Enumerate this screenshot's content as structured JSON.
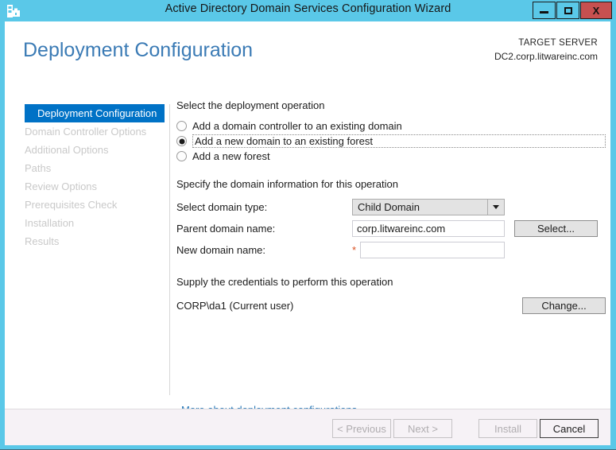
{
  "window": {
    "title": "Active Directory Domain Services Configuration Wizard",
    "icon": "server-manager-icon",
    "minimize_label": "Minimize",
    "maximize_label": "Maximize",
    "close_label": "X",
    "titlebar_color": "#5ac8e8",
    "close_color": "#c75050"
  },
  "header": {
    "page_title": "Deployment Configuration",
    "target_server_label": "TARGET SERVER",
    "target_server_name": "DC2.corp.litwareinc.com",
    "title_color": "#3b7bb5"
  },
  "sidebar": {
    "active_color": "#0072c6",
    "items": [
      {
        "label": "Deployment Configuration",
        "state": "active"
      },
      {
        "label": "Domain Controller Options",
        "state": "disabled"
      },
      {
        "label": "Additional Options",
        "state": "disabled"
      },
      {
        "label": "Paths",
        "state": "disabled"
      },
      {
        "label": "Review Options",
        "state": "disabled"
      },
      {
        "label": "Prerequisites Check",
        "state": "disabled"
      },
      {
        "label": "Installation",
        "state": "disabled"
      },
      {
        "label": "Results",
        "state": "disabled"
      }
    ]
  },
  "main": {
    "operation_section_label": "Select the deployment operation",
    "operations": [
      {
        "label": "Add a domain controller to an existing domain",
        "selected": false,
        "focused": false
      },
      {
        "label": "Add a new domain to an existing forest",
        "selected": true,
        "focused": true
      },
      {
        "label": "Add a new forest",
        "selected": false,
        "focused": false
      }
    ],
    "domain_section_label": "Specify the domain information for this operation",
    "domain_type_label": "Select domain type:",
    "domain_type_value": "Child Domain",
    "parent_domain_label": "Parent domain name:",
    "parent_domain_value": "corp.litwareinc.com",
    "parent_domain_placeholder": "",
    "select_button": "Select...",
    "new_domain_label": "New domain name:",
    "new_domain_value": "",
    "new_domain_placeholder": "",
    "required_marker": "*",
    "required_marker_color": "#d94f20",
    "credentials_section_label": "Supply the credentials to perform this operation",
    "credentials_user": "CORP\\da1 (Current user)",
    "change_button": "Change...",
    "more_link": "More about deployment configurations",
    "link_color": "#2878b8"
  },
  "footer": {
    "previous_button": "< Previous",
    "next_button": "Next >",
    "install_button": "Install",
    "cancel_button": "Cancel",
    "previous_enabled": false,
    "next_enabled": false,
    "install_enabled": false,
    "cancel_enabled": true
  }
}
